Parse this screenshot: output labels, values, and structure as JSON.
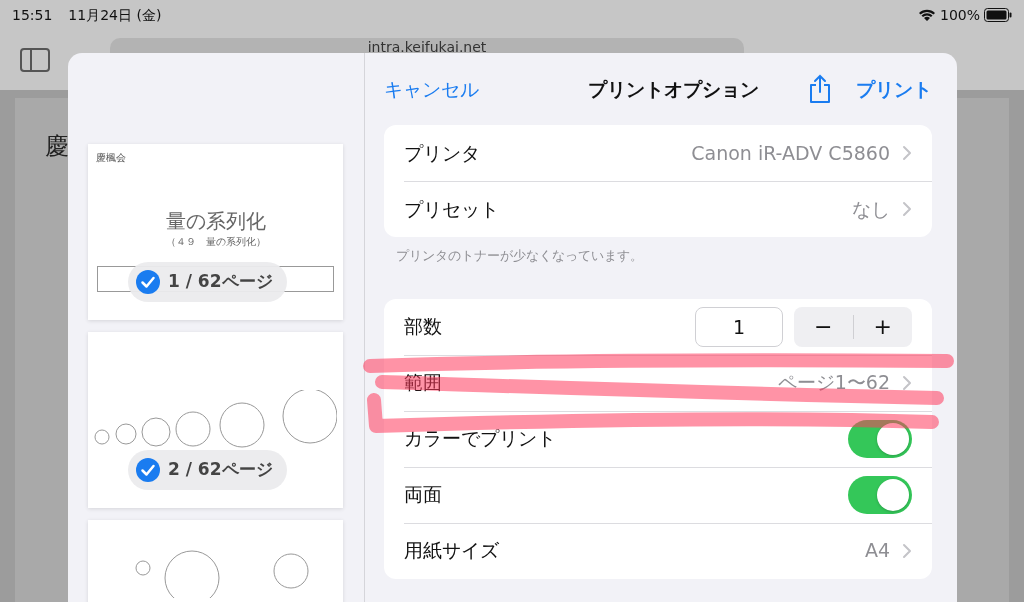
{
  "status_bar": {
    "time": "15:51",
    "date": "11月24日 (金)",
    "battery": "100%"
  },
  "browser": {
    "address": "intra.keifukai.net"
  },
  "background": {
    "page_text": "慶"
  },
  "preview": {
    "pages": [
      {
        "kind": "title",
        "header": "慶楓会",
        "title": "量の系列化",
        "subtitle": "（４９　量の系列化）",
        "badge": "1 / 62ページ",
        "selected": true
      },
      {
        "kind": "circles-row",
        "badge": "2 / 62ページ",
        "selected": true
      },
      {
        "kind": "circles-scatter"
      }
    ]
  },
  "print_options": {
    "cancel": "キャンセル",
    "title": "プリントオプション",
    "print": "プリント",
    "groups": [
      {
        "rows": [
          {
            "kind": "nav",
            "label": "プリンタ",
            "value": "Canon iR-ADV C5860"
          },
          {
            "kind": "nav",
            "label": "プリセット",
            "value": "なし"
          }
        ],
        "footer": "プリンタのトナーが少なくなっています。"
      },
      {
        "rows": [
          {
            "kind": "stepper",
            "label": "部数",
            "value": "1",
            "minus": "−",
            "plus": "+"
          },
          {
            "kind": "nav",
            "label": "範囲",
            "value": "ページ1〜62"
          },
          {
            "kind": "toggle",
            "label": "カラーでプリント",
            "on": true
          },
          {
            "kind": "toggle",
            "label": "両面",
            "on": true
          },
          {
            "kind": "nav",
            "label": "用紙サイズ",
            "value": "A4"
          }
        ]
      }
    ]
  }
}
